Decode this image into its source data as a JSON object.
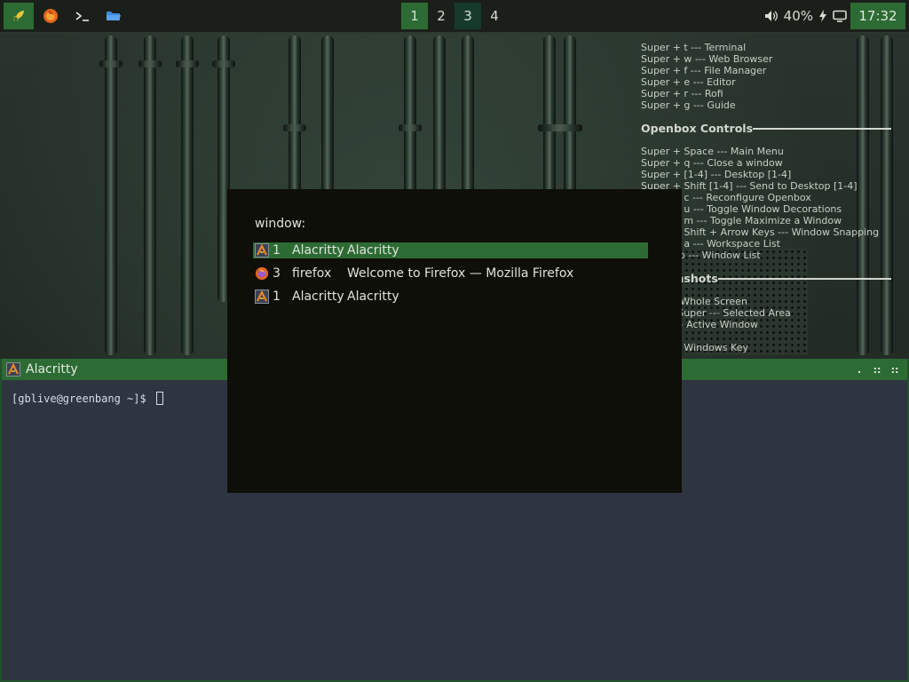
{
  "top_panel": {
    "launchers": [
      {
        "name": "menu",
        "icon": "rocket-icon"
      },
      {
        "name": "browser",
        "icon": "firefox-icon"
      },
      {
        "name": "terminal",
        "icon": "terminal-prompt-icon"
      },
      {
        "name": "files",
        "icon": "folder-icon"
      }
    ],
    "workspaces": [
      {
        "label": "1",
        "state": "active"
      },
      {
        "label": "2",
        "state": "empty"
      },
      {
        "label": "3",
        "state": "occupied"
      },
      {
        "label": "4",
        "state": "empty"
      }
    ],
    "tray": {
      "volume_icon": "speaker-icon",
      "battery_percent": "40%",
      "battery_icon": "charging-bolt-icon",
      "display_icon": "monitor-icon"
    },
    "clock": "17:32"
  },
  "conky": {
    "apps": [
      "Super + t --- Terminal",
      "Super + w --- Web Browser",
      "Super + f --- File Manager",
      "Super + e --- Editor",
      "Super + r --- Rofi",
      "Super + g --- Guide"
    ],
    "openbox_heading": "Openbox Controls",
    "openbox": [
      "Super + Space --- Main Menu",
      "Super + q --- Close a window",
      "Super + [1-4] --- Desktop [1-4]",
      "Super + Shift [1-4] --- Send to Desktop [1-4]",
      "Super + c --- Reconfigure Openbox",
      "Super + u --- Toggle Window Decorations",
      "Super + m --- Toggle Maximize a Window",
      "Super + Shift + Arrow Keys --- Window Snapping",
      "Super + a --- Workspace List",
      "Alt + Tab --- Window List"
    ],
    "screenshots_heading": "Screenshots",
    "screenshots": [
      "Print --- Whole Screen",
      "Shift + Super --- Selected Area",
      "Super  --- Active Window"
    ],
    "footer": "Super = Windows Key"
  },
  "terminal": {
    "title": "Alacritty",
    "prompt": "[gblive@greenbang ~]$ ",
    "buttons": {
      "iconify": ".",
      "maximize": "::",
      "close": "::"
    }
  },
  "rofi": {
    "prompt": "window:",
    "entries": [
      {
        "icon": "alacritty-icon",
        "workspace": "1",
        "class": "Alacritty",
        "title": "Alacritty",
        "selected": true
      },
      {
        "icon": "firefox-icon",
        "workspace": "3",
        "class": "firefox",
        "title": "Welcome to Firefox — Mozilla Firefox",
        "selected": false
      },
      {
        "icon": "alacritty-icon",
        "workspace": "1",
        "class": "Alacritty",
        "title": "Alacritty",
        "selected": false
      }
    ]
  },
  "colors": {
    "accent_green": "#2c6b34",
    "occupied_ws": "#163a2c",
    "panel_bg": "#1b1f1a",
    "rofi_bg": "#0f0f0a",
    "terminal_bg": "#2e3440"
  }
}
